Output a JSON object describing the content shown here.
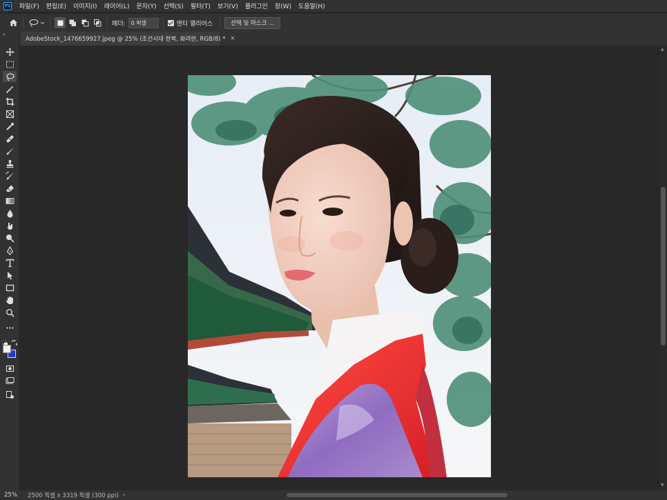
{
  "app": {
    "logo": "Ps"
  },
  "menu": [
    "파일(F)",
    "편집(E)",
    "이미지(I)",
    "레이어(L)",
    "문자(Y)",
    "선택(S)",
    "필터(T)",
    "보기(V)",
    "플러그인",
    "창(W)",
    "도움말(H)"
  ],
  "options": {
    "feather_label": "페더:",
    "feather_value": "0 픽셀",
    "antialias_label": "앤티 앨리어스",
    "select_mask_label": "선택 및 마스크 ..."
  },
  "document": {
    "tab_title": "AdobeStock_1476659927.jpeg @ 25% (조선시대 한복, 화려한, RGB/8) *",
    "close_glyph": "×"
  },
  "status": {
    "zoom": "25%",
    "doc_info": "2500 픽셀 x 3319 픽셀 (300 ppi)",
    "arrow": "›"
  },
  "toolbar": {
    "collapse": "»",
    "tools": [
      "move-tool",
      "marquee-tool",
      "lasso-tool",
      "magic-wand-tool",
      "crop-tool",
      "frame-tool",
      "eyedropper-tool",
      "healing-brush-tool",
      "brush-tool",
      "clone-stamp-tool",
      "history-brush-tool",
      "eraser-tool",
      "gradient-tool",
      "blur-tool",
      "dodge-tool",
      "pen-tool",
      "type-tool",
      "path-selection-tool",
      "rectangle-tool",
      "hand-tool",
      "zoom-tool",
      "more-tools"
    ],
    "foreground_color": "#f2f2f2",
    "background_color": "#1a3fd6"
  },
  "colors": {
    "chrome": "#323232",
    "canvas": "#282828",
    "accent": "#31a8ff"
  }
}
